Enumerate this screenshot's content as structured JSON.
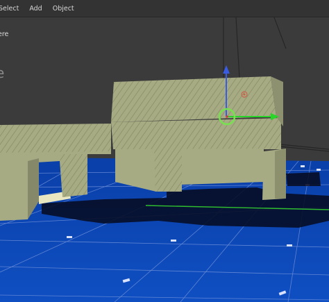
{
  "header": {
    "menus": [
      {
        "label": "Select"
      },
      {
        "label": "Add"
      },
      {
        "label": "Object"
      }
    ]
  },
  "viewport": {
    "object_label": "ere",
    "overlay_glyph": "e",
    "colors": {
      "background": "#3a3a3a",
      "floor": "#0d47b5",
      "model": "#a7ab83",
      "gizmo_circle": "#6dd64a",
      "axis_x": "#2ad52a",
      "axis_z": "#3a5ce0"
    },
    "icons": [
      "move-gizmo-icon",
      "x-axis-arrow-icon",
      "z-axis-arrow-icon",
      "light-source-icon"
    ]
  }
}
